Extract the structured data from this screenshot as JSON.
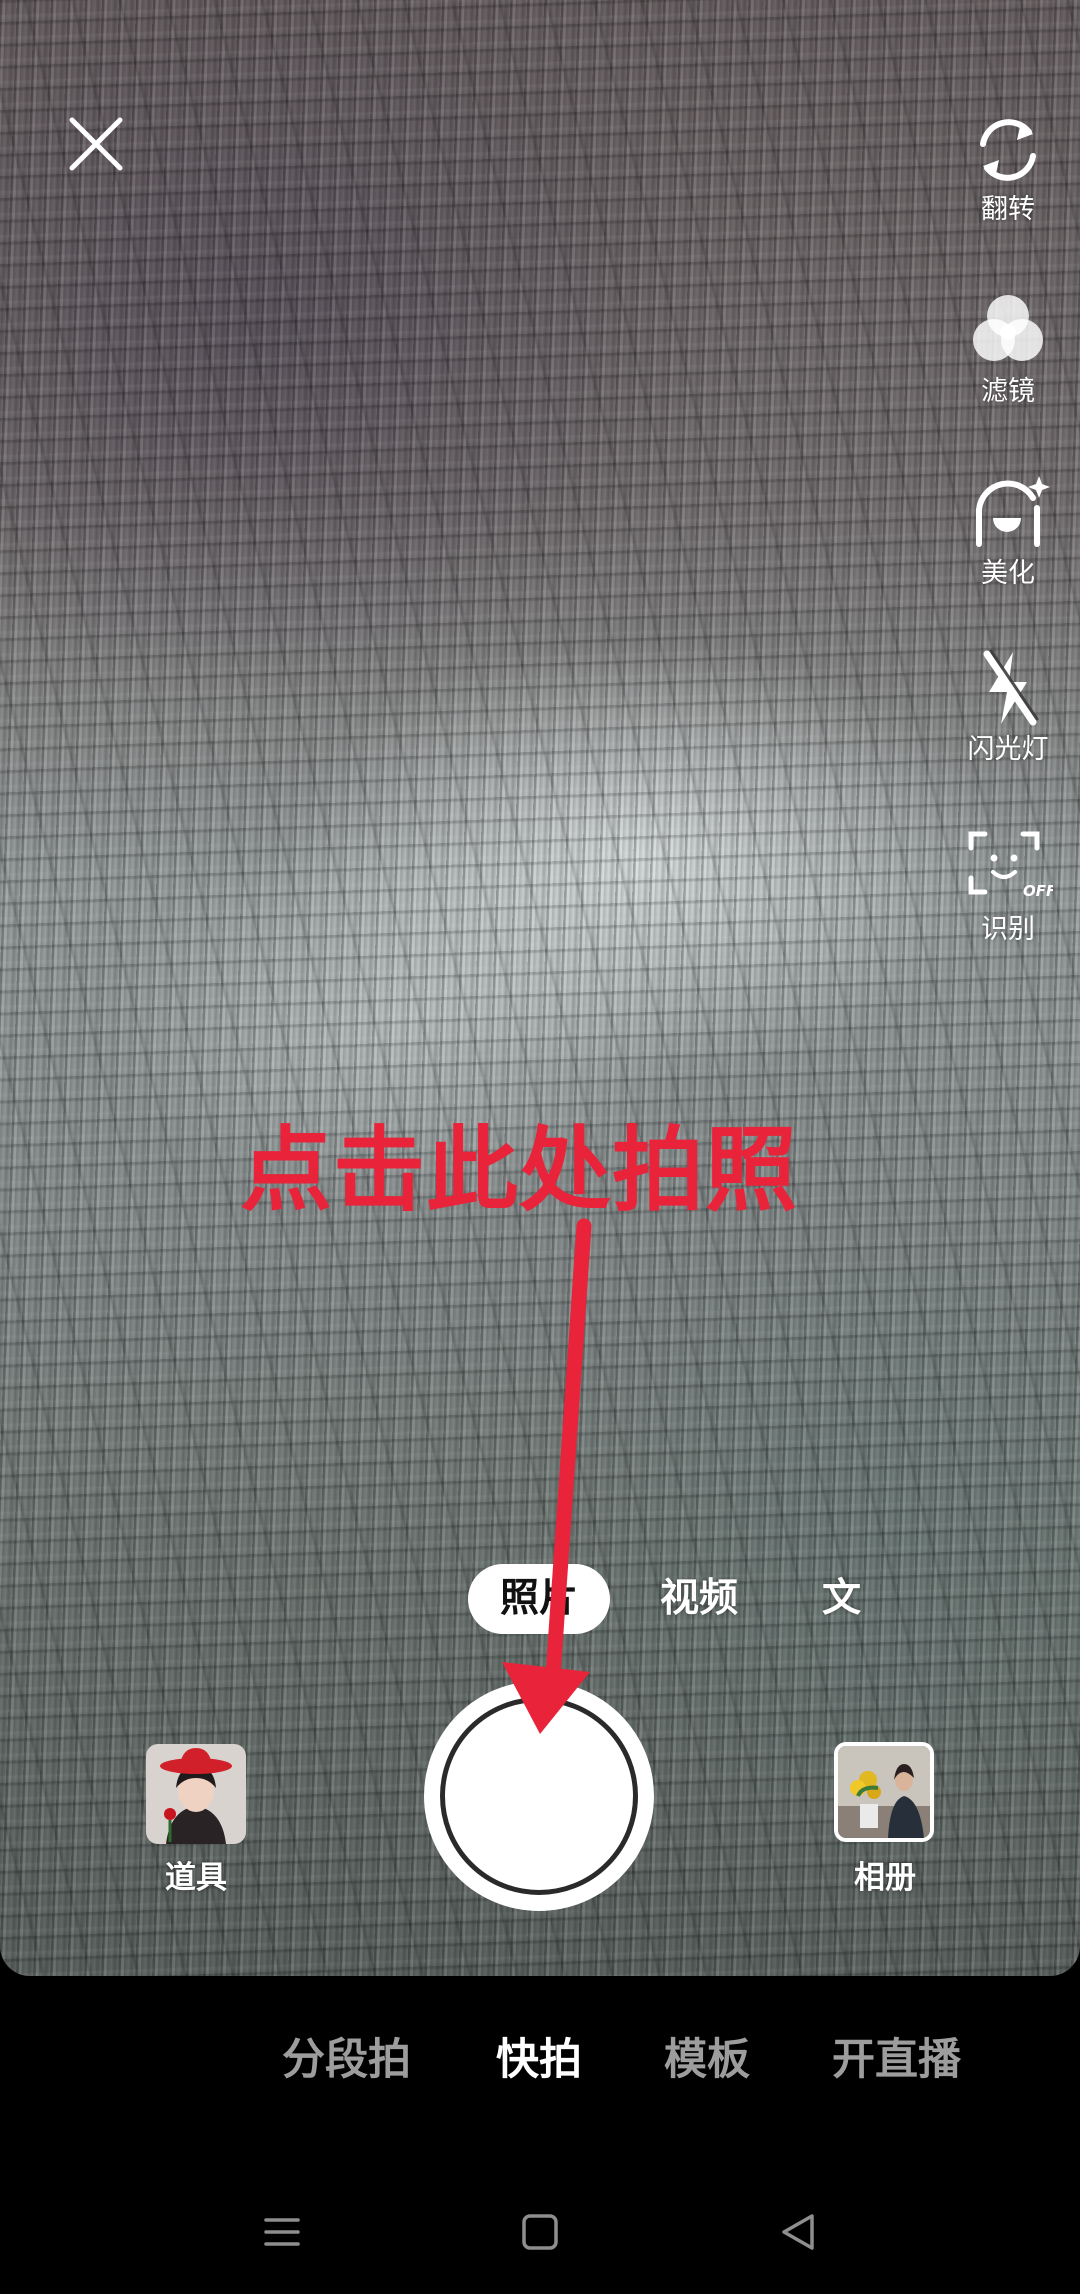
{
  "toolbar": {
    "close_icon": "close-icon",
    "tools": [
      {
        "icon": "flip-camera-icon",
        "label": "翻转"
      },
      {
        "icon": "filter-icon",
        "label": "滤镜"
      },
      {
        "icon": "beautify-icon",
        "label": "美化"
      },
      {
        "icon": "flash-off-icon",
        "label": "闪光灯"
      },
      {
        "icon": "face-recognition-icon",
        "label": "识别"
      }
    ]
  },
  "annotation": {
    "text": "点击此处拍照",
    "color": "#e8233a"
  },
  "capture_modes": {
    "selected": "照片",
    "items": [
      "照片",
      "视频",
      "文"
    ]
  },
  "props": {
    "label": "道具",
    "icon": "props-thumbnail"
  },
  "album": {
    "label": "相册",
    "icon": "album-thumbnail"
  },
  "bottom_tabs": {
    "active": "快拍",
    "items": [
      "分段拍",
      "快拍",
      "模板",
      "开直播"
    ]
  },
  "navbar": {
    "icons": [
      "menu-icon",
      "home-icon",
      "back-icon"
    ]
  }
}
